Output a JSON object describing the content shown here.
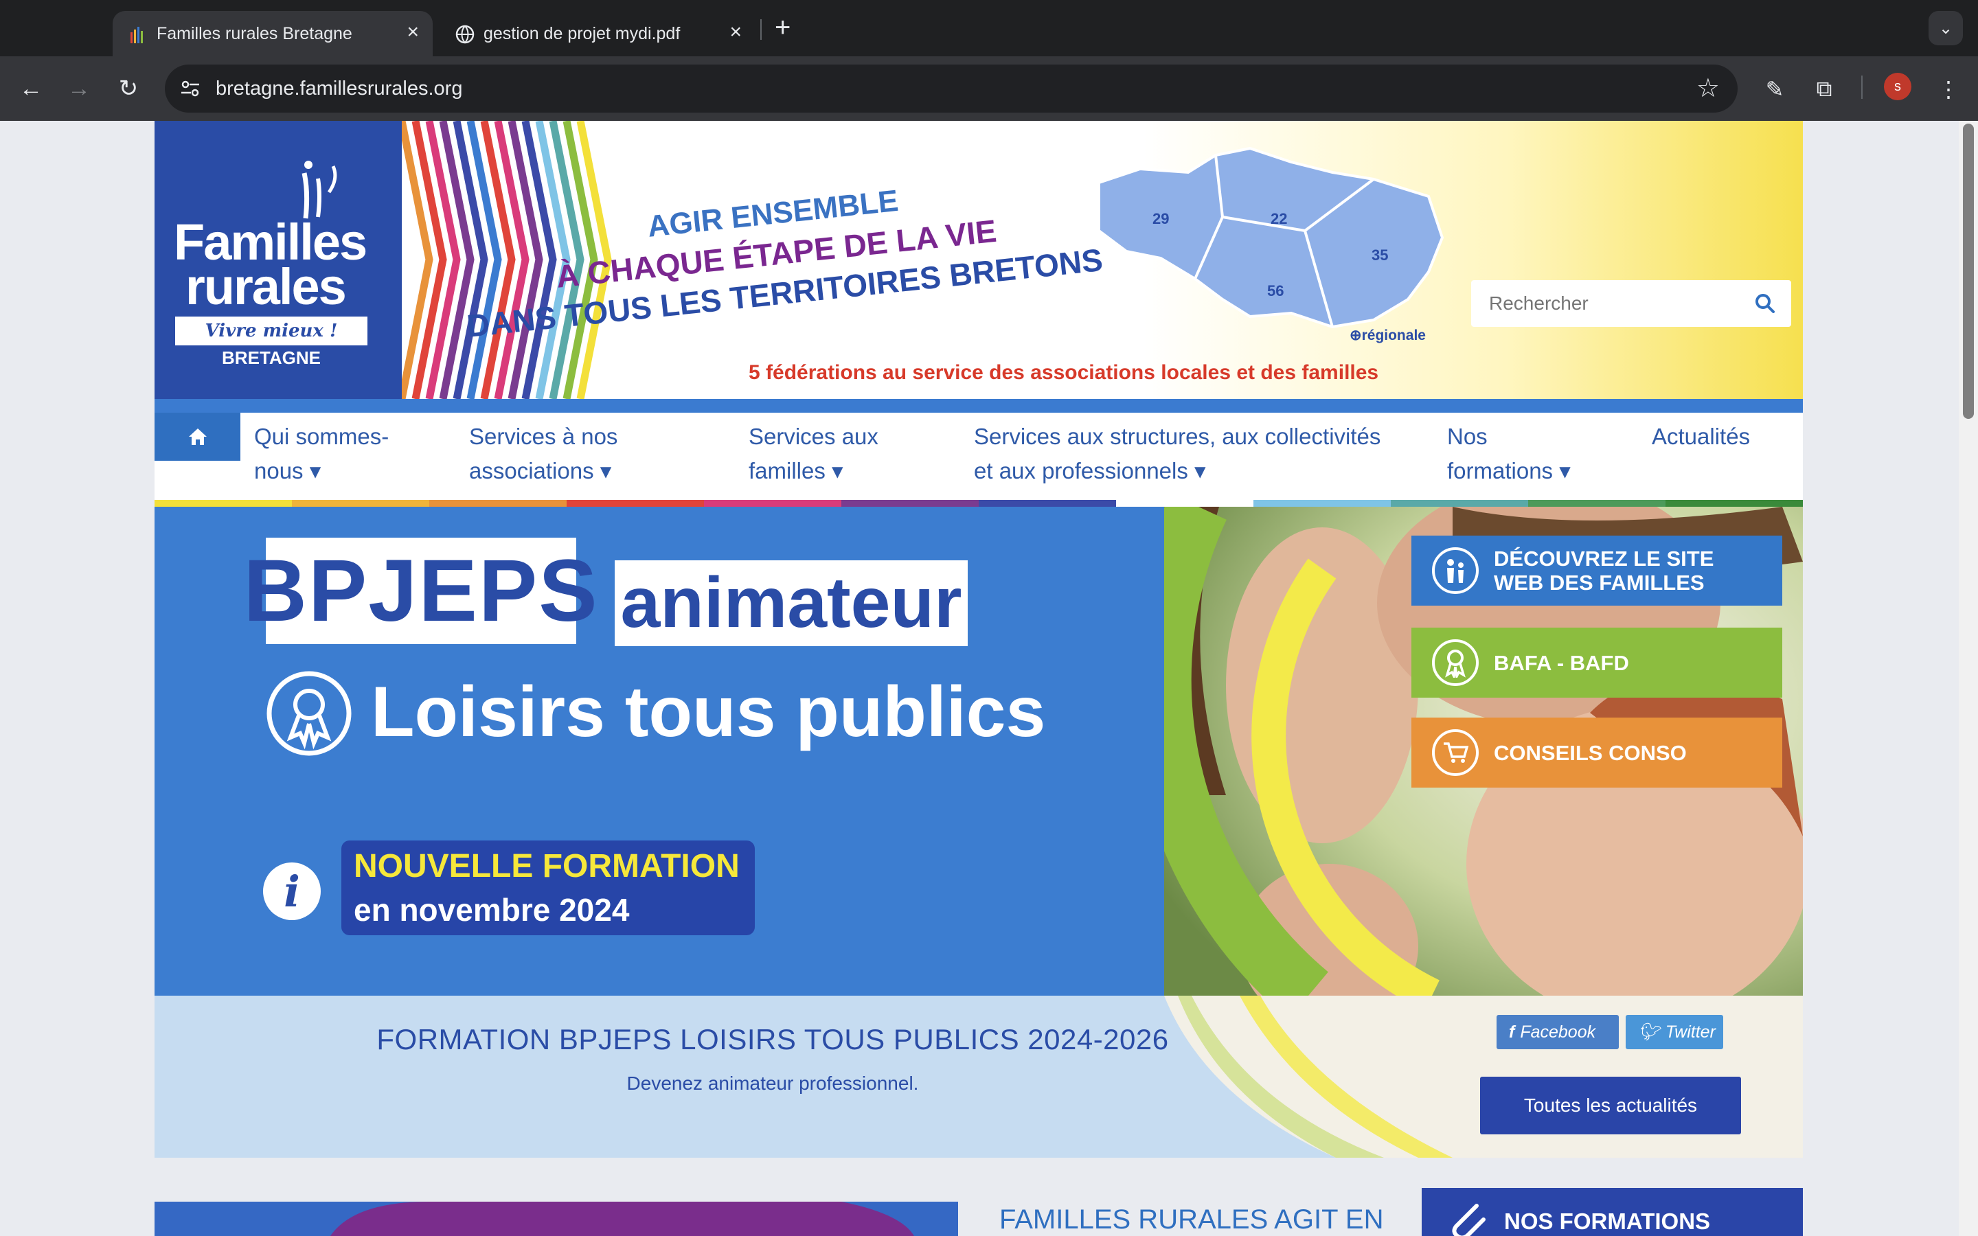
{
  "browser": {
    "tabs": [
      {
        "title": "Familles rurales Bretagne",
        "active": true
      },
      {
        "title": "gestion de projet mydi.pdf",
        "active": false
      }
    ],
    "url": "bretagne.famillesrurales.org",
    "profile_initial": "s"
  },
  "banner": {
    "logo_line1": "Familles",
    "logo_line2": "rurales",
    "logo_tagline": "Vivre mieux !",
    "logo_region": "BRETAGNE",
    "slogan1": "AGIR ENSEMBLE",
    "slogan2": "À CHAQUE ÉTAPE DE LA VIE",
    "slogan3": "DANS TOUS LES TERRITOIRES BRETONS",
    "federations": "5 fédérations au service des associations locales et des familles",
    "map_labels": [
      "29",
      "22",
      "35",
      "56"
    ],
    "map_regional": "⊕régionale",
    "search_placeholder": "Rechercher"
  },
  "nav": {
    "items": [
      {
        "line1": "Qui sommes-",
        "line2": "nous ▾"
      },
      {
        "line1": "Services à nos",
        "line2": "associations ▾"
      },
      {
        "line1": "Services aux",
        "line2": "familles ▾"
      },
      {
        "line1": "Services aux structures, aux collectivités",
        "line2": "et aux professionnels ▾"
      },
      {
        "line1": "Nos",
        "line2": "formations ▾"
      },
      {
        "line1": "Actualités",
        "line2": ""
      }
    ],
    "bar_colors": [
      "#f3e03a",
      "#f0b43a",
      "#e8923a",
      "#e0443a",
      "#d93b7a",
      "#7a3b90",
      "#3b4aa8",
      "#ffffff",
      "#7fc4e6",
      "#5aa9a8",
      "#4c9a5a",
      "#3a8a3a"
    ]
  },
  "hero": {
    "bpjeps": "BPJEPS",
    "animateur": "animateur",
    "loisirs": "Loisirs tous publics",
    "nouvelle_formation": "NOUVELLE FORMATION",
    "date": "en novembre 2024",
    "ctas": [
      {
        "label_line1": "DÉCOUVREZ LE SITE",
        "label_line2": "WEB DES FAMILLES",
        "icon": "family-icon"
      },
      {
        "label_line1": "BAFA - BAFD",
        "label_line2": "",
        "icon": "medal-icon"
      },
      {
        "label_line1": "CONSEILS CONSO",
        "label_line2": "",
        "icon": "cart-icon"
      }
    ]
  },
  "caption": {
    "title": "FORMATION BPJEPS LOISIRS TOUS PUBLICS 2024-2026",
    "subtitle": "Devenez animateur professionnel.",
    "facebook": "Facebook",
    "twitter": "Twitter",
    "all_news": "Toutes les actualités"
  },
  "lower": {
    "title": "FAMILLES RURALES AGIT EN",
    "formations": "NOS FORMATIONS"
  }
}
